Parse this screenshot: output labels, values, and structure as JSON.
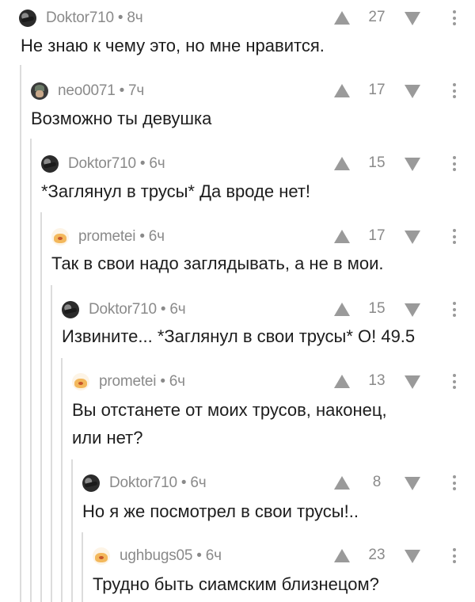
{
  "comments": [
    {
      "avatar_icon": "dark-avatar-icon",
      "author": "Doktor710",
      "separator": "•",
      "time": "8ч",
      "score": "27",
      "text": "Не знаю к чему это, но мне нравится."
    },
    {
      "avatar_icon": "neo-avatar-icon",
      "author": "neo0071",
      "separator": "•",
      "time": "7ч",
      "score": "17",
      "text": "Возможно ты девушка"
    },
    {
      "avatar_icon": "dark-avatar-icon",
      "author": "Doktor710",
      "separator": "•",
      "time": "6ч",
      "score": "15",
      "text": "*Заглянул в трусы* Да вроде нет!"
    },
    {
      "avatar_icon": "cat-avatar-icon",
      "author": "prometei",
      "separator": "•",
      "time": "6ч",
      "score": "17",
      "text": "Так в свои надо заглядывать, а не в мои."
    },
    {
      "avatar_icon": "dark-avatar-icon",
      "author": "Doktor710",
      "separator": "•",
      "time": "6ч",
      "score": "15",
      "text": "Извините... *Заглянул в свои трусы* О! 49.5"
    },
    {
      "avatar_icon": "cat-avatar-icon",
      "author": "prometei",
      "separator": "•",
      "time": "6ч",
      "score": "13",
      "text_line1": "Вы отстанете от моих трусов, наконец,",
      "text_line2": "или нет?"
    },
    {
      "avatar_icon": "dark-avatar-icon",
      "author": "Doktor710",
      "separator": "•",
      "time": "6ч",
      "score": "8",
      "text": "Но я же посмотрел в свои трусы!.."
    },
    {
      "avatar_icon": "cat-avatar-icon",
      "author": "ughbugs05",
      "separator": "•",
      "time": "6ч",
      "score": "23",
      "text": "Трудно быть сиамским близнецом?"
    }
  ]
}
